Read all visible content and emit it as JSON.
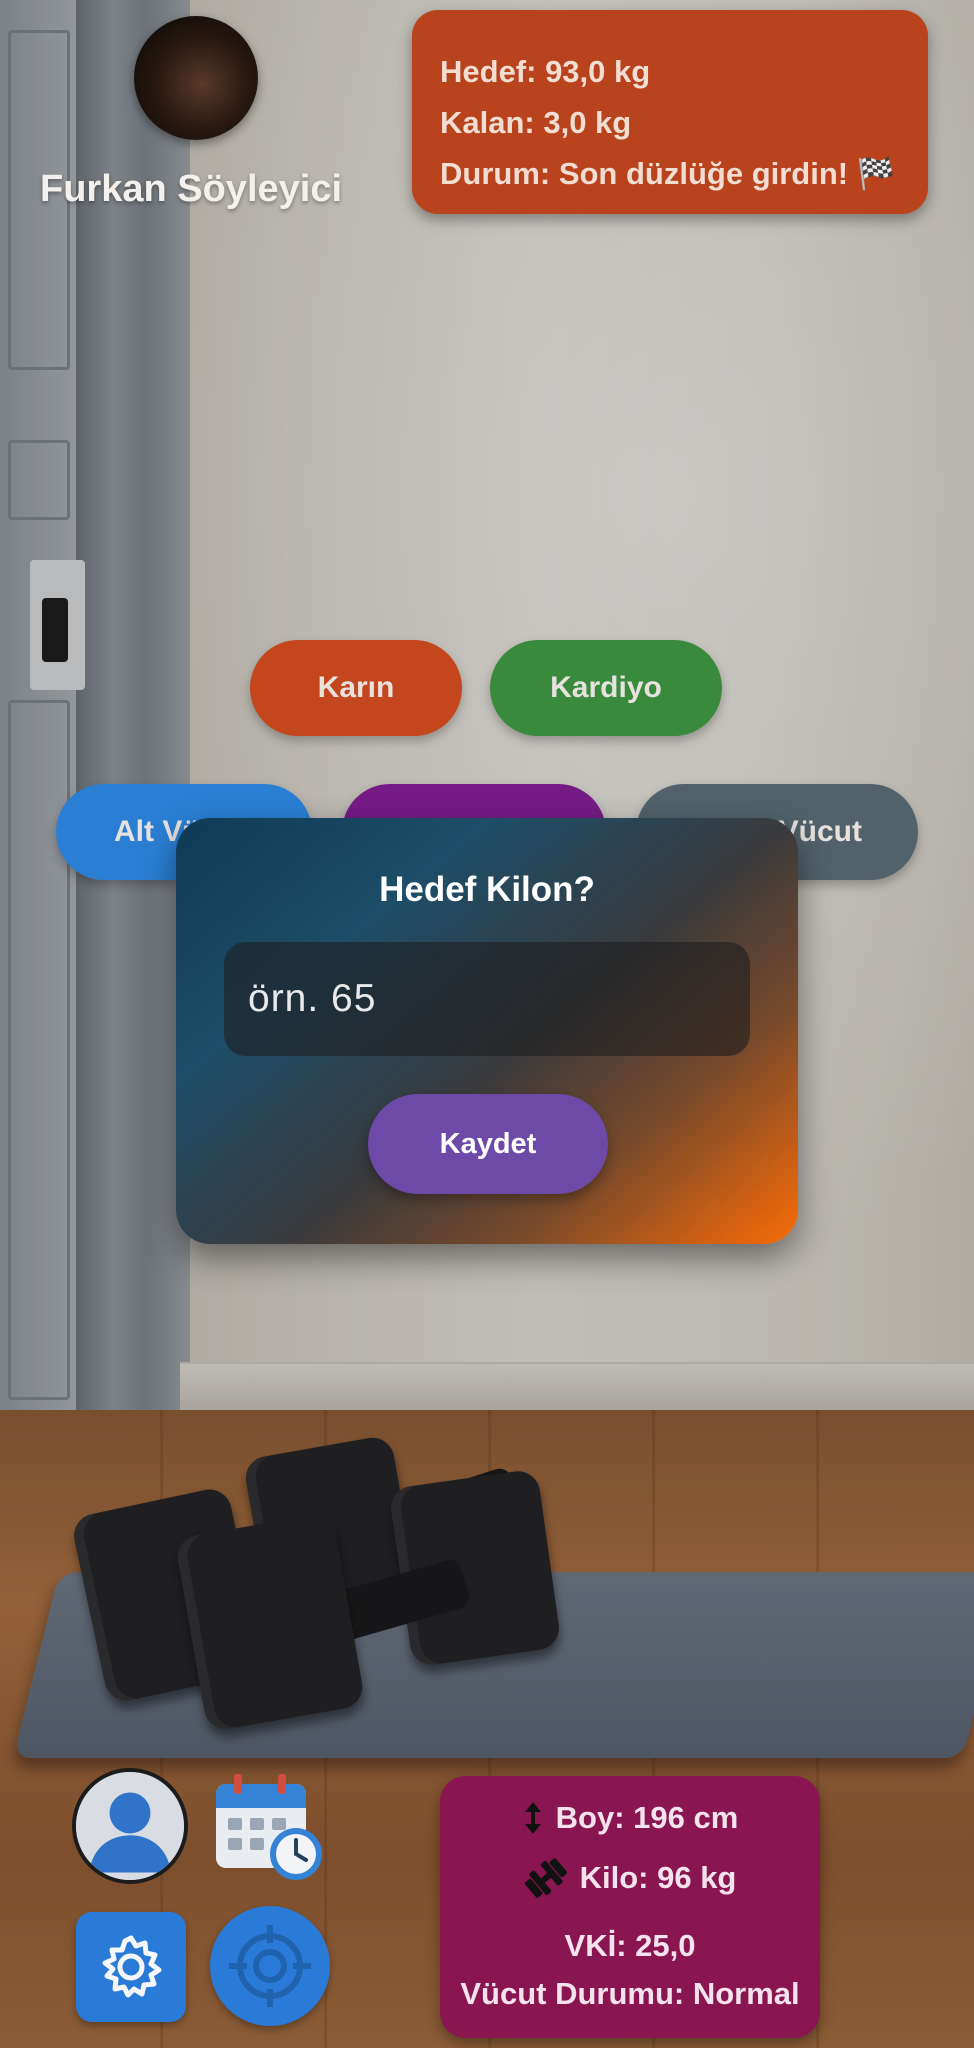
{
  "profile": {
    "name": "Furkan Söyleyici"
  },
  "goal_card": {
    "target_line": "Hedef: 93,0 kg",
    "remaining_line": "Kalan: 3,0 kg",
    "status_line": "Durum: Son düzlüğe girdin! 🏁"
  },
  "categories": [
    {
      "label": "Karın",
      "color": "#c4461c"
    },
    {
      "label": "Kardiyo",
      "color": "#3a8a3e"
    },
    {
      "label": "Alt Vü",
      "color": "#2a7fd4"
    },
    {
      "label": "",
      "color": "#751b86"
    },
    {
      "label": "Vücut",
      "color": "#52616a"
    }
  ],
  "dialog": {
    "title": "Hedef Kilon?",
    "input_placeholder": "örn. 65",
    "save_label": "Kaydet"
  },
  "stats": {
    "height": "Boy: 196 cm",
    "weight": "Kilo: 96 kg",
    "bmi": "VKİ: 25,0",
    "body_status": "Vücut Durumu: Normal"
  },
  "icons": {
    "profile": "user-avatar-icon",
    "calendar": "calendar-clock-icon",
    "settings": "gear-icon",
    "target": "target-icon",
    "height": "vertical-arrows-icon",
    "weight": "dumbbell-icon"
  },
  "colors": {
    "goal_card": "#b8431d",
    "stats_card": "#8a1651",
    "save_button": "#6d4aa8",
    "dock_button": "#2a7bd8"
  }
}
